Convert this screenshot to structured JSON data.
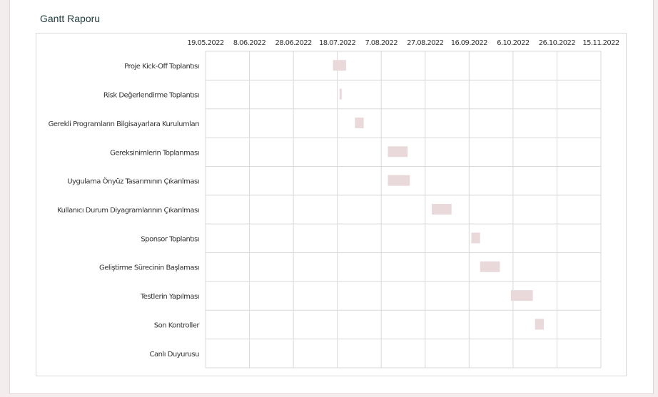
{
  "report": {
    "title": "Gantt Raporu"
  },
  "chart_data": {
    "type": "gantt",
    "title": "",
    "xlabel": "",
    "ylabel": "",
    "x_ticks": [
      "19.05.2022",
      "8.06.2022",
      "28.06.2022",
      "18.07.2022",
      "7.08.2022",
      "27.08.2022",
      "16.09.2022",
      "6.10.2022",
      "26.10.2022",
      "15.11.2022"
    ],
    "x_range": [
      "2022-05-19",
      "2022-11-15"
    ],
    "grid": true,
    "bar_color": "#ead9da",
    "tasks": [
      {
        "name": "Proje Kick-Off Toplantısı",
        "start": "2022-07-16",
        "end": "2022-07-22"
      },
      {
        "name": "Risk Değerlendirme Toplantısı",
        "start": "2022-07-19",
        "end": "2022-07-20"
      },
      {
        "name": "Gerekli Programların Bilgisayarlara Kurulumları",
        "start": "2022-07-26",
        "end": "2022-07-30"
      },
      {
        "name": "Gereksinimlerin Toplanması",
        "start": "2022-08-10",
        "end": "2022-08-19"
      },
      {
        "name": "Uygulama Önyüz Tasarımının Çıkarılması",
        "start": "2022-08-10",
        "end": "2022-08-20"
      },
      {
        "name": "Kullanıcı Durum Diyagramlarının Çıkarılması",
        "start": "2022-08-30",
        "end": "2022-09-08"
      },
      {
        "name": "Sponsor Toplantısı",
        "start": "2022-09-17",
        "end": "2022-09-21"
      },
      {
        "name": "Geliştirme Sürecinin Başlaması",
        "start": "2022-09-21",
        "end": "2022-09-30"
      },
      {
        "name": "Testlerin Yapılması",
        "start": "2022-10-05",
        "end": "2022-10-15"
      },
      {
        "name": "Son Kontroller",
        "start": "2022-10-16",
        "end": "2022-10-20"
      },
      {
        "name": "Canlı Duyurusu",
        "start": null,
        "end": null
      }
    ]
  }
}
